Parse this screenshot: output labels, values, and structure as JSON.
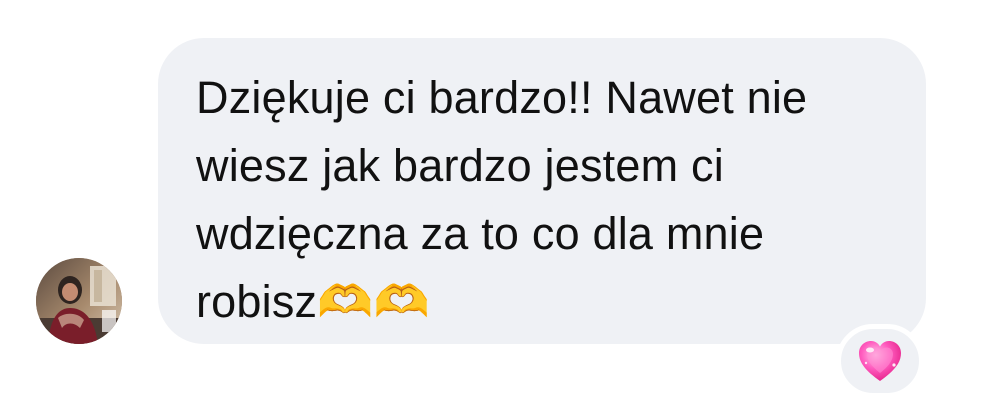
{
  "conversation": {
    "incoming_message": {
      "text": "Dziękuje ci bardzo!! Nawet nie\nwiesz jak bardzo jestem ci\nwdzięczna za to co dla mnie\nrobisz🫶🫶",
      "bubble_color": "#eff1f5",
      "text_color": "#111111"
    },
    "reaction": {
      "icon": "sparkling-heart-icon",
      "color": "#ff4fb0"
    },
    "sender": {
      "avatar_icon": "user-avatar-photo"
    }
  }
}
